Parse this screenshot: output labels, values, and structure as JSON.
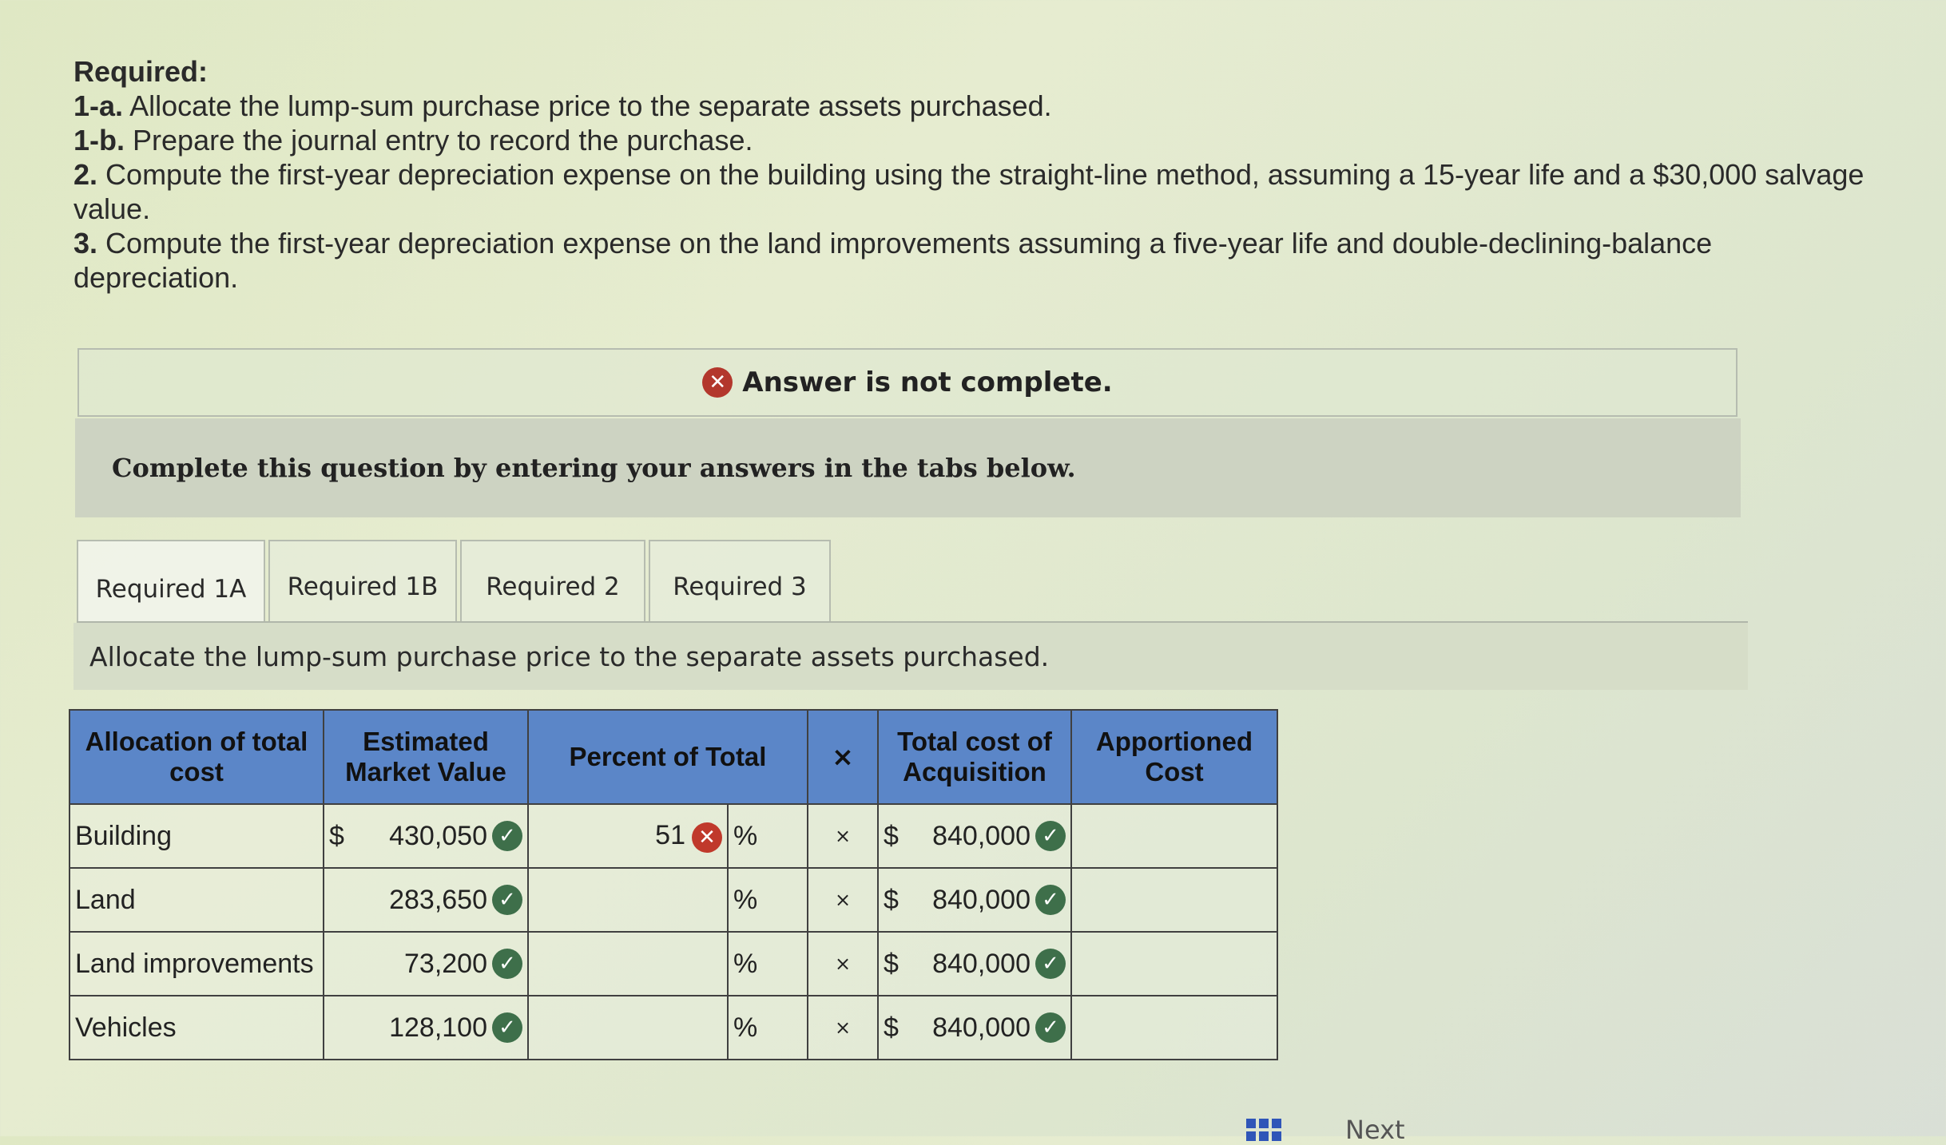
{
  "required": {
    "heading": "Required:",
    "items": [
      {
        "num": "1-a.",
        "text": "Allocate the lump-sum purchase price to the separate assets purchased."
      },
      {
        "num": "1-b.",
        "text": "Prepare the journal entry to record the purchase."
      },
      {
        "num": "2.",
        "text": "Compute the first-year depreciation expense on the building using the straight-line method, assuming a 15-year life and a $30,000 salvage value."
      },
      {
        "num": "3.",
        "text": "Compute the first-year depreciation expense on the land improvements assuming a five-year life and double-declining-balance depreciation."
      }
    ]
  },
  "status": {
    "text": "Answer is not complete.",
    "icon": "x-circle-icon",
    "color": "#b3372c"
  },
  "instructions": "Complete this question by entering your answers in the tabs below.",
  "tabs": [
    {
      "label": "Required 1A",
      "active": true
    },
    {
      "label": "Required 1B",
      "active": false
    },
    {
      "label": "Required 2",
      "active": false
    },
    {
      "label": "Required 3",
      "active": false
    }
  ],
  "task_text": "Allocate the lump-sum purchase price to the separate assets purchased.",
  "table": {
    "headers": {
      "allocation": "Allocation of total cost",
      "emv": "Estimated Market Value",
      "percent": "Percent of Total",
      "times": "×",
      "total": "Total cost of Acquisition",
      "apportioned": "Apportioned Cost"
    },
    "rows": [
      {
        "label": "Building",
        "currency": "$",
        "emv": "430,050",
        "percent": "51",
        "percent_status": "incorrect",
        "pct_symbol": "%",
        "times": "×",
        "total_currency": "$",
        "total": "840,000",
        "apportioned": ""
      },
      {
        "label": "Land",
        "currency": "",
        "emv": "283,650",
        "percent": "",
        "percent_status": "",
        "pct_symbol": "%",
        "times": "×",
        "total_currency": "$",
        "total": "840,000",
        "apportioned": ""
      },
      {
        "label": "Land improvements",
        "currency": "",
        "emv": "73,200",
        "percent": "",
        "percent_status": "",
        "pct_symbol": "%",
        "times": "×",
        "total_currency": "$",
        "total": "840,000",
        "apportioned": ""
      },
      {
        "label": "Vehicles",
        "currency": "",
        "emv": "128,100",
        "percent": "",
        "percent_status": "",
        "pct_symbol": "%",
        "times": "×",
        "total_currency": "$",
        "total": "840,000",
        "apportioned": ""
      }
    ],
    "header_color": "#5b86c8",
    "correct_color": "#3e6f4a",
    "incorrect_color": "#c0392b"
  },
  "footer": {
    "next_label": "Next"
  }
}
